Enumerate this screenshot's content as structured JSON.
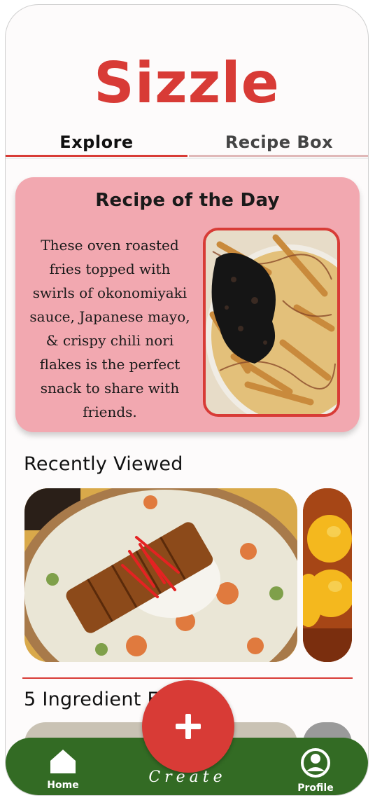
{
  "app": {
    "title": "Sizzle"
  },
  "tabs": [
    {
      "label": "Explore",
      "active": true
    },
    {
      "label": "Recipe Box",
      "active": false
    }
  ],
  "recipe_of_the_day": {
    "heading": "Recipe of the Day",
    "description_lines": [
      "These oven roasted",
      "fries topped with",
      "swirls of okonomiyaki",
      "sauce, Japanese mayo,",
      "& crispy chili nori",
      "flakes is the perfect",
      "snack to share with",
      "friends."
    ],
    "image": "okonomiyaki-fries-photo"
  },
  "recently_viewed": {
    "heading": "Recently Viewed",
    "items": [
      {
        "image": "katsu-curry-rice-photo"
      },
      {
        "image": "soy-marinated-eggs-photo"
      }
    ]
  },
  "five_ingredient": {
    "heading": "5 Ingredient F"
  },
  "nav": {
    "home_label": "Home",
    "create_label": "Create",
    "profile_label": "Profile"
  },
  "colors": {
    "brand_red": "#d83b36",
    "card_pink": "#f2a8b0",
    "nav_green": "#336b24"
  }
}
